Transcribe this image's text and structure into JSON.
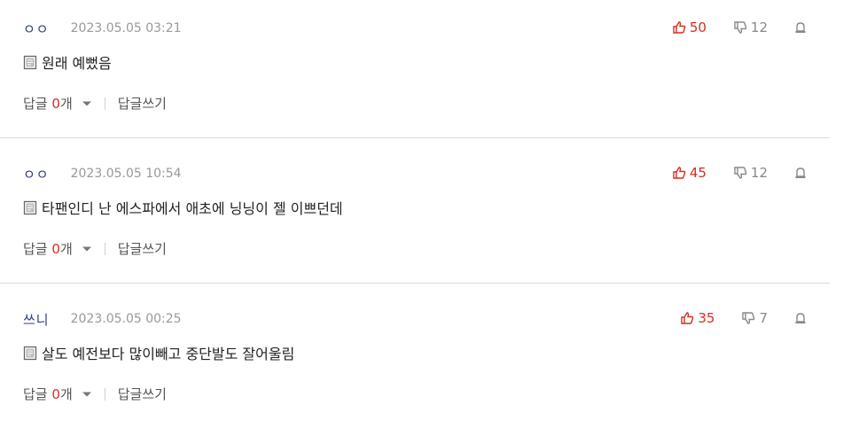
{
  "comments": [
    {
      "author": "ㅇㅇ",
      "date": "2023.05.05 03:21",
      "text": "원래 예뻤음",
      "likes": "50",
      "dislikes": "12",
      "reply_label": "답글",
      "reply_count": "0",
      "reply_unit": "개",
      "write_label": "답글쓰기"
    },
    {
      "author": "ㅇㅇ",
      "date": "2023.05.05 10:54",
      "text": "타팬인디 난 에스파에서 애초에 닝닝이 젤 이쁘던데",
      "likes": "45",
      "dislikes": "12",
      "reply_label": "답글",
      "reply_count": "0",
      "reply_unit": "개",
      "write_label": "답글쓰기"
    },
    {
      "author": "쓰니",
      "date": "2023.05.05 00:25",
      "text": "살도 예전보다 많이빼고 중단발도 잘어울림",
      "likes": "35",
      "dislikes": "7",
      "reply_label": "답글",
      "reply_count": "0",
      "reply_unit": "개",
      "write_label": "답글쓰기"
    }
  ],
  "colors": {
    "accent_red": "#d32f1e",
    "author_blue": "#2d3a8c",
    "muted": "#999999"
  },
  "icons": {
    "like": "thumbs-up-icon",
    "dislike": "thumbs-down-icon",
    "report": "siren-icon",
    "doc": "document-icon",
    "caret": "caret-down-icon"
  }
}
